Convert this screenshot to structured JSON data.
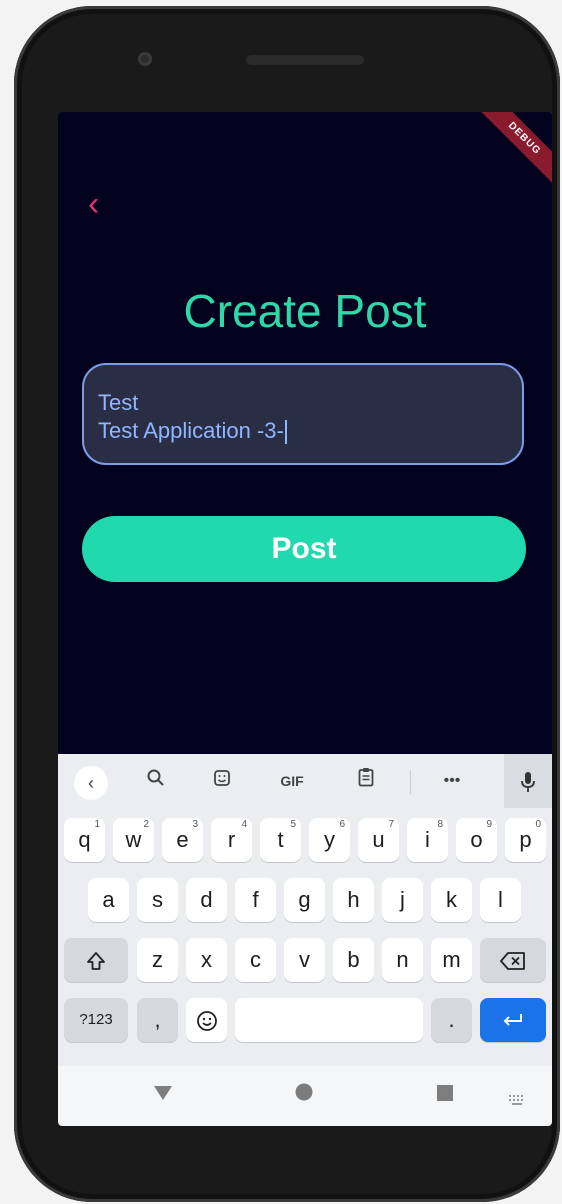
{
  "app": {
    "debug_banner": "DEBUG",
    "back_icon": "chevron-left-icon",
    "title": "Create Post",
    "text_field": {
      "line1": "Test",
      "line2": "Test Application -3-"
    },
    "post_button": "Post",
    "colors": {
      "background": "#02021f",
      "accent_green": "#20d9ae",
      "title_green": "#2fd8a8",
      "back_pink": "#e0356f",
      "field_border": "#7a9de6",
      "field_text": "#8fb6ff"
    }
  },
  "keyboard": {
    "toolbar": [
      "chevron-left-icon",
      "search-icon",
      "sticker-icon",
      "GIF",
      "clipboard-icon",
      "more-icon",
      "mic-icon"
    ],
    "gif_label": "GIF",
    "row1": [
      {
        "k": "q",
        "n": "1"
      },
      {
        "k": "w",
        "n": "2"
      },
      {
        "k": "e",
        "n": "3"
      },
      {
        "k": "r",
        "n": "4"
      },
      {
        "k": "t",
        "n": "5"
      },
      {
        "k": "y",
        "n": "6"
      },
      {
        "k": "u",
        "n": "7"
      },
      {
        "k": "i",
        "n": "8"
      },
      {
        "k": "o",
        "n": "9"
      },
      {
        "k": "p",
        "n": "0"
      }
    ],
    "row2": [
      "a",
      "s",
      "d",
      "f",
      "g",
      "h",
      "j",
      "k",
      "l"
    ],
    "row3": [
      "z",
      "x",
      "c",
      "v",
      "b",
      "n",
      "m"
    ],
    "symbols_key": "?123",
    "comma_key": ",",
    "period_key": "."
  }
}
